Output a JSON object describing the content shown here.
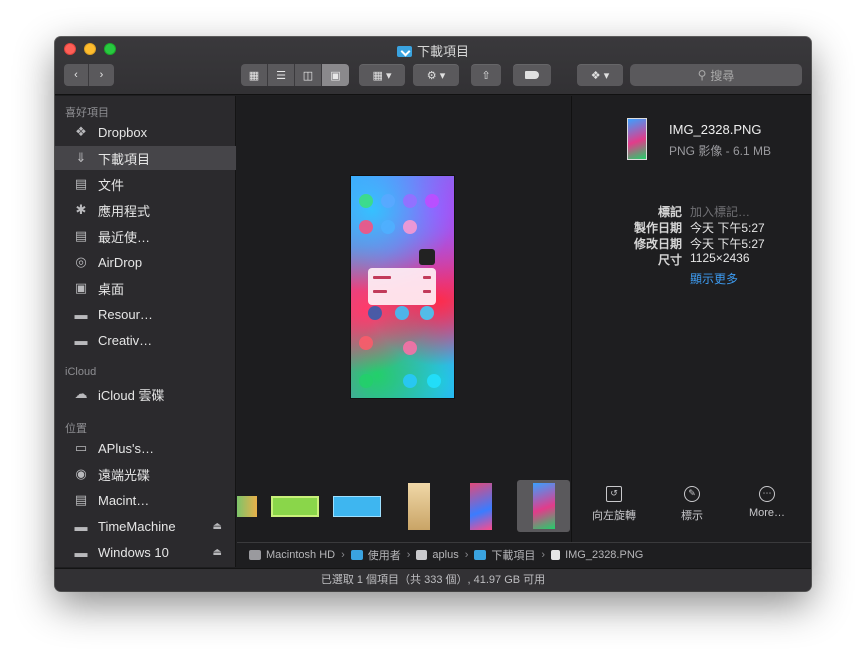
{
  "window": {
    "title": "下載項目"
  },
  "toolbar": {
    "back_icon": "chevron-left-icon",
    "forward_icon": "chevron-right-icon",
    "view_modes": [
      "icon-view",
      "list-view",
      "column-view",
      "gallery-view"
    ],
    "active_view": "gallery-view",
    "search_placeholder": "搜尋"
  },
  "sidebar": {
    "favorites_header": "喜好項目",
    "favorites": [
      {
        "label": "Dropbox",
        "icon": "dropbox-icon"
      },
      {
        "label": "下載項目",
        "icon": "download-icon",
        "selected": true
      },
      {
        "label": "文件",
        "icon": "document-icon"
      },
      {
        "label": "應用程式",
        "icon": "applications-icon"
      },
      {
        "label": "最近使…",
        "icon": "recents-icon"
      },
      {
        "label": "AirDrop",
        "icon": "airdrop-icon"
      },
      {
        "label": "桌面",
        "icon": "desktop-icon"
      },
      {
        "label": "Resour…",
        "icon": "folder-icon"
      },
      {
        "label": "Creativ…",
        "icon": "folder-icon"
      }
    ],
    "icloud_header": "iCloud",
    "icloud": [
      {
        "label": "iCloud 雲碟",
        "icon": "cloud-icon"
      }
    ],
    "locations_header": "位置",
    "locations": [
      {
        "label": "APlus's…",
        "icon": "laptop-icon"
      },
      {
        "label": "遠端光碟",
        "icon": "disc-icon"
      },
      {
        "label": "Macint…",
        "icon": "harddisk-icon"
      },
      {
        "label": "TimeMachine",
        "icon": "drive-icon",
        "eject": true
      },
      {
        "label": "Windows 10",
        "icon": "drive-icon",
        "eject": true
      }
    ]
  },
  "info_panel": {
    "file_name": "IMG_2328.PNG",
    "file_kind": "PNG 影像 - 6.1 MB",
    "rows": [
      {
        "key": "標記",
        "value": "加入標記…",
        "placeholder": true
      },
      {
        "key": "製作日期",
        "value": "今天 下午5:27"
      },
      {
        "key": "修改日期",
        "value": "今天 下午5:27"
      },
      {
        "key": "尺寸",
        "value": "1125×2436"
      }
    ],
    "show_more": "顯示更多",
    "actions": [
      {
        "label": "向左旋轉",
        "icon": "rotate-left-icon"
      },
      {
        "label": "標示",
        "icon": "markup-icon"
      },
      {
        "label": "More…",
        "icon": "more-icon"
      }
    ]
  },
  "path_bar": [
    {
      "label": "Macintosh HD",
      "icon": "harddisk-icon"
    },
    {
      "label": "使用者",
      "icon": "folder-icon"
    },
    {
      "label": "aplus",
      "icon": "home-icon"
    },
    {
      "label": "下載項目",
      "icon": "downloads-folder-icon"
    },
    {
      "label": "IMG_2328.PNG",
      "icon": "file-icon"
    }
  ],
  "status": {
    "text": "已選取 1 個項目（共 333 個）, 41.97 GB 可用"
  }
}
